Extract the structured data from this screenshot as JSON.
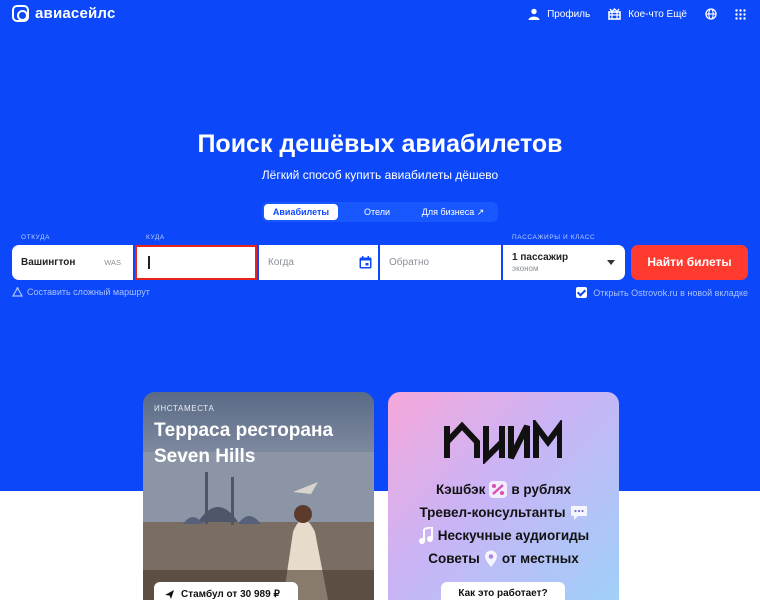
{
  "header": {
    "logo_text": "авиасейлс",
    "profile_label": "Профиль",
    "more_label": "Кое-что Ещё",
    "icons": [
      "user-icon",
      "gift-icon",
      "globe-icon",
      "grid-icon"
    ]
  },
  "hero": {
    "title": "Поиск дешёвых авиабилетов",
    "subtitle": "Лёгкий способ купить авиабилеты дёшево"
  },
  "tabs": [
    {
      "label": "Авиабилеты",
      "active": true
    },
    {
      "label": "Отели",
      "active": false
    },
    {
      "label": "Для бизнеса ↗",
      "active": false
    }
  ],
  "search": {
    "from_label": "ОТКУДА",
    "from_city": "Вашингтон",
    "from_code": "WAS",
    "to_label": "КУДА",
    "to_value": "",
    "when_placeholder": "Когда",
    "back_placeholder": "Обратно",
    "passengers_label": "ПАССАЖИРЫ И КЛАСС",
    "passengers": "1 пассажир",
    "class": "эконом",
    "submit": "Найти билеты",
    "complex_route": "Составить сложный маршрут",
    "ostrovok": "Открыть Ostrovok.ru в новой вкладке",
    "ostrovok_checked": true
  },
  "cards": {
    "left": {
      "kicker": "ИНСТАМЕСТА",
      "title": "Терраса ресторана Seven Hills",
      "pill": "Стамбул от 30 989 ₽"
    },
    "right": {
      "lines": [
        "Кэшбэк",
        "в рублях",
        "Тревел-консультанты",
        "Нескучные аудиогиды",
        "Советы",
        "от местных"
      ],
      "button": "Как это работает?"
    }
  },
  "colors": {
    "brand_blue": "#0c48fa",
    "accent_red": "#ff3b30"
  }
}
